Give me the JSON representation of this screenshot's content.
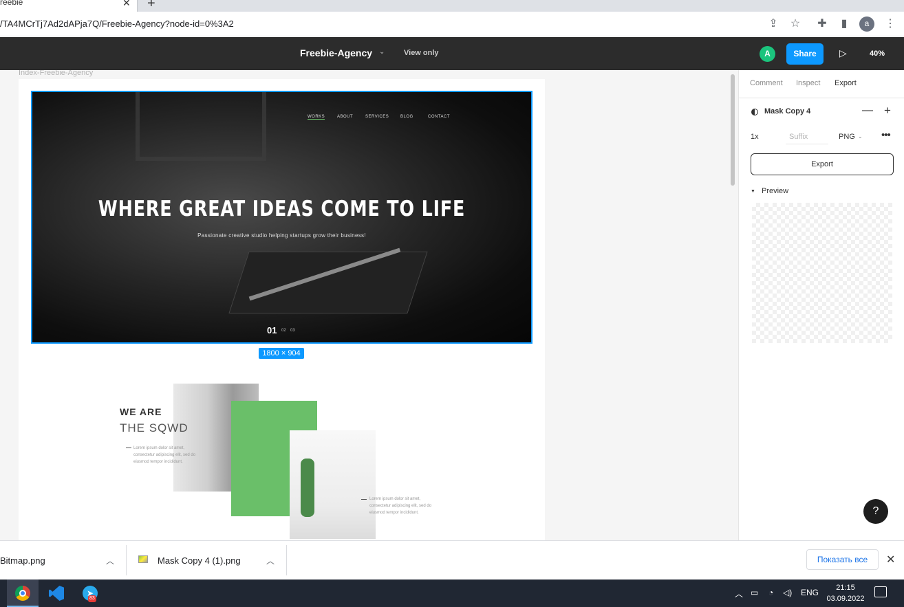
{
  "browser": {
    "tab_title": "reebie",
    "tab_close": "✕",
    "new_tab": "+",
    "url": "/TA4MCrTj7Ad2dAPja7Q/Freebie-Agency?node-id=0%3A2",
    "profile_letter": "a"
  },
  "figma": {
    "file_title": "Freebie-Agency",
    "view_mode": "View only",
    "user_initial": "A",
    "share_label": "Share",
    "zoom": "40%",
    "frame_label": "Index-Freebie-Agency",
    "selection_size": "1800 × 904"
  },
  "hero": {
    "nav": [
      "WORKS",
      "ABOUT",
      "SERVICES",
      "BLOG",
      "CONTACT"
    ],
    "title": "WHERE GREAT IDEAS COME TO LIFE",
    "subtitle": "Passionate creative studio helping startups grow their business!",
    "page_current": "01",
    "page_others": [
      "02",
      "03"
    ]
  },
  "about": {
    "we_are": "WE ARE",
    "the_sqwd": "THE SQWD",
    "lorem1": [
      "Lorem ipsum dolor sit amet,",
      "consectetur adipiscing elit, sed do",
      "eiusmod tempor incididunt."
    ],
    "lorem2": [
      "Lorem ipsum dolor sit amet,",
      "consectetur adipiscing elit, sed do",
      "eiusmod tempor incididunt."
    ]
  },
  "panel": {
    "tabs": [
      "Comment",
      "Inspect",
      "Export"
    ],
    "active_tab": "Export",
    "layer_name": "Mask Copy 4",
    "scale": "1x",
    "suffix_placeholder": "Suffix",
    "format": "PNG",
    "export_label": "Export",
    "preview_label": "Preview",
    "help": "?"
  },
  "downloads": {
    "item1": "Bitmap.png",
    "item2": "Mask Copy 4 (1).png",
    "show_all": "Показать все"
  },
  "taskbar": {
    "telegram_badge": "83",
    "lang": "ENG",
    "time": "21:15",
    "date": "03.09.2022"
  },
  "colors": {
    "figma_blue": "#0d99ff",
    "brand_green": "#6abf69",
    "figma_dark": "#2c2c2c"
  }
}
